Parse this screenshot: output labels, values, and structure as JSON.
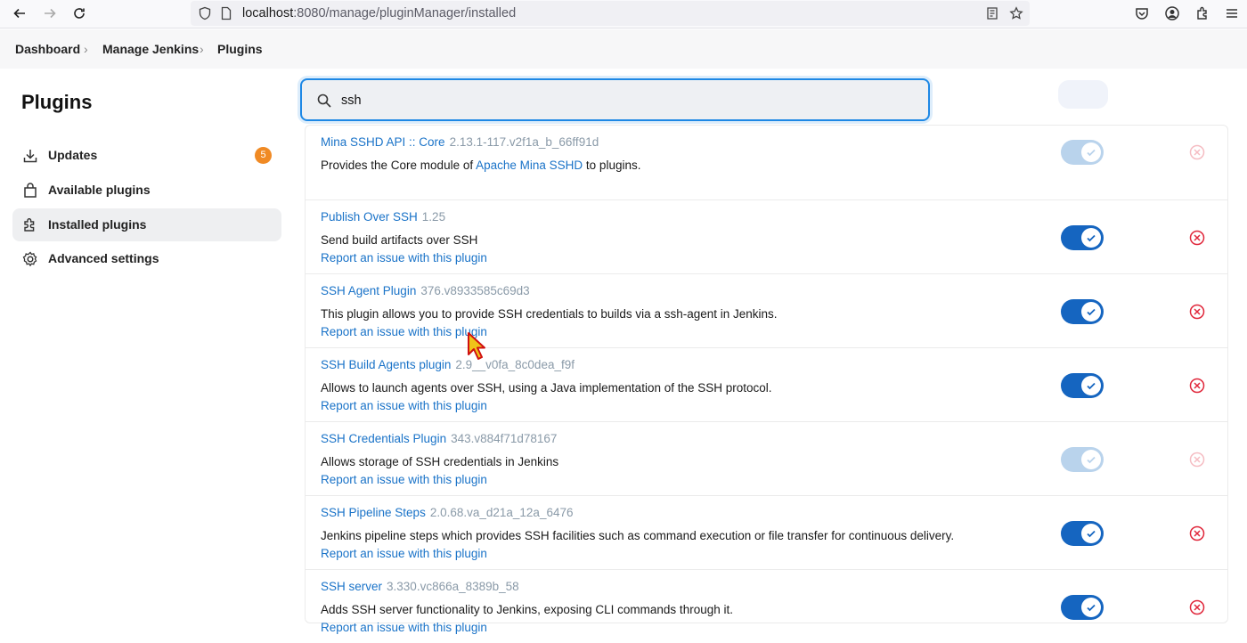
{
  "browser": {
    "url_host": "localhost",
    "url_rest": ":8080/manage/pluginManager/installed"
  },
  "breadcrumb": {
    "items": [
      "Dashboard",
      "Manage Jenkins",
      "Plugins"
    ]
  },
  "sidebar": {
    "title": "Plugins",
    "items": [
      {
        "label": "Updates",
        "badge": "5"
      },
      {
        "label": "Available plugins"
      },
      {
        "label": "Installed plugins"
      },
      {
        "label": "Advanced settings"
      }
    ]
  },
  "search": {
    "value": "ssh"
  },
  "plugins": [
    {
      "name": "Mina SSHD API :: Core",
      "version": "2.13.1-117.v2f1a_b_66ff91d",
      "desc_before": "Provides the Core module of ",
      "desc_link": "Apache Mina SSHD",
      "desc_after": " to plugins.",
      "report": "",
      "enabled": true,
      "locked": true
    },
    {
      "name": "Publish Over SSH",
      "version": "1.25",
      "desc_before": "Send build artifacts over SSH",
      "desc_link": "",
      "desc_after": "",
      "report": "Report an issue with this plugin",
      "enabled": true,
      "locked": false
    },
    {
      "name": "SSH Agent Plugin",
      "version": "376.v8933585c69d3",
      "desc_before": "This plugin allows you to provide SSH credentials to builds via a ssh-agent in Jenkins.",
      "desc_link": "",
      "desc_after": "",
      "report": "Report an issue with this plugin",
      "enabled": true,
      "locked": false
    },
    {
      "name": "SSH Build Agents plugin",
      "version": "2.9__v0fa_8c0dea_f9f",
      "desc_before": "Allows to launch agents over SSH, using a Java implementation of the SSH protocol.",
      "desc_link": "",
      "desc_after": "",
      "report": "Report an issue with this plugin",
      "enabled": true,
      "locked": false
    },
    {
      "name": "SSH Credentials Plugin",
      "version": "343.v884f71d78167",
      "desc_before": "Allows storage of SSH credentials in Jenkins",
      "desc_link": "",
      "desc_after": "",
      "report": "Report an issue with this plugin",
      "enabled": true,
      "locked": true
    },
    {
      "name": "SSH Pipeline Steps",
      "version": "2.0.68.va_d21a_12a_6476",
      "desc_before": "Jenkins pipeline steps which provides SSH facilities such as command execution or file transfer for continuous delivery.",
      "desc_link": "",
      "desc_after": "",
      "report": "Report an issue with this plugin",
      "enabled": true,
      "locked": false
    },
    {
      "name": "SSH server",
      "version": "3.330.vc866a_8389b_58",
      "desc_before": "Adds SSH server functionality to Jenkins, exposing CLI commands through it.",
      "desc_link": "",
      "desc_after": "",
      "report": "Report an issue with this plugin",
      "enabled": true,
      "locked": false
    }
  ],
  "colors": {
    "link": "#1a73c8",
    "toggle_on": "#1565c0",
    "toggle_locked": "#b9d3ec",
    "uninstall": "#e0263a",
    "badge": "#f08a24"
  }
}
